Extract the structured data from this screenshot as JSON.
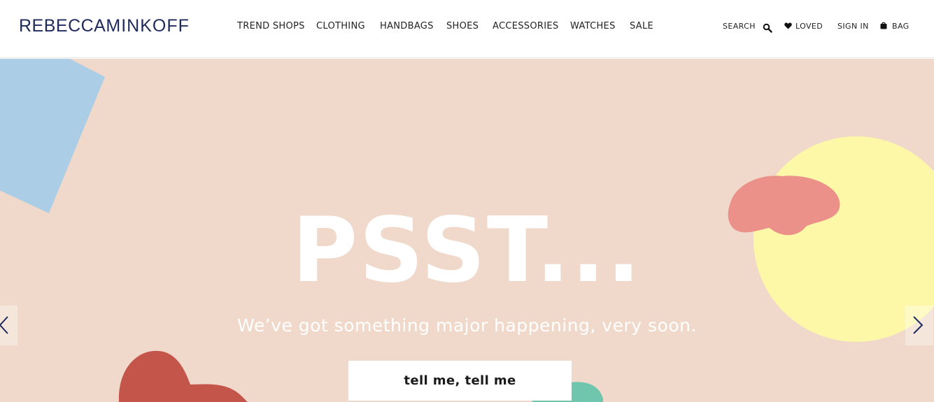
{
  "brand": {
    "part1": "REBECCA",
    "part2": "MINKOFF"
  },
  "nav": {
    "items": [
      {
        "label": "TREND SHOPS"
      },
      {
        "label": "CLOTHING"
      },
      {
        "label": "HANDBAGS"
      },
      {
        "label": "SHOES"
      },
      {
        "label": "ACCESSORIES"
      },
      {
        "label": "WATCHES"
      },
      {
        "label": "SALE"
      }
    ]
  },
  "utility": {
    "search_label": "SEARCH",
    "loved_label": "LOVED",
    "signin_label": "SIGN IN",
    "bag_label": "BAG",
    "icons": [
      "search-icon",
      "heart-icon",
      "bag-icon"
    ]
  },
  "hero": {
    "headline": "PSST...",
    "subheadline": "We’ve got something major happening, very soon.",
    "cta_label": "tell me, tell me",
    "colors": {
      "background": "#f0d9ca",
      "blue_shape": "#abcde6",
      "yellow_circle": "#fcf8a8",
      "pink_blob": "#ec918a",
      "red_blob": "#c4554b",
      "teal_blob": "#6fc6ad"
    },
    "carousel": {
      "prev_icon": "chevron-left-icon",
      "next_icon": "chevron-right-icon"
    }
  },
  "colors": {
    "brand_navy": "#1f2a5c",
    "text": "#222222"
  }
}
